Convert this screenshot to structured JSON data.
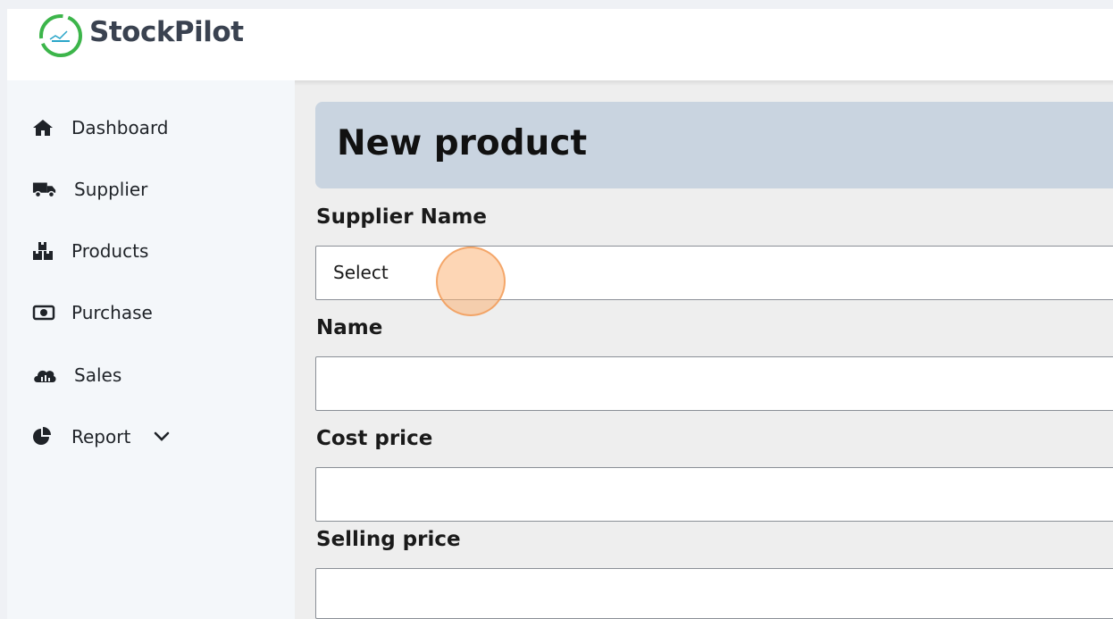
{
  "app": {
    "brand": "StockPilot"
  },
  "sidebar": {
    "items": [
      {
        "label": "Dashboard",
        "icon": "home-icon"
      },
      {
        "label": "Supplier",
        "icon": "truck-icon"
      },
      {
        "label": "Products",
        "icon": "boxes-icon"
      },
      {
        "label": "Purchase",
        "icon": "money-bill-icon"
      },
      {
        "label": "Sales",
        "icon": "cloud-chart-icon"
      },
      {
        "label": "Report",
        "icon": "pie-chart-icon",
        "has_submenu": true
      }
    ]
  },
  "main": {
    "title": "New product",
    "form": {
      "supplier_label": "Supplier Name",
      "supplier_value": "Select",
      "name_label": "Name",
      "name_value": "",
      "cost_label": "Cost price",
      "cost_value": "",
      "selling_label": "Selling price",
      "selling_value": ""
    }
  },
  "colors": {
    "logo_ring": "#3cb54a",
    "title_banner": "#c9d4e0",
    "sidebar_bg": "#f4f7fa",
    "main_bg": "#eeeeee",
    "click_indicator": "#fcb478"
  }
}
